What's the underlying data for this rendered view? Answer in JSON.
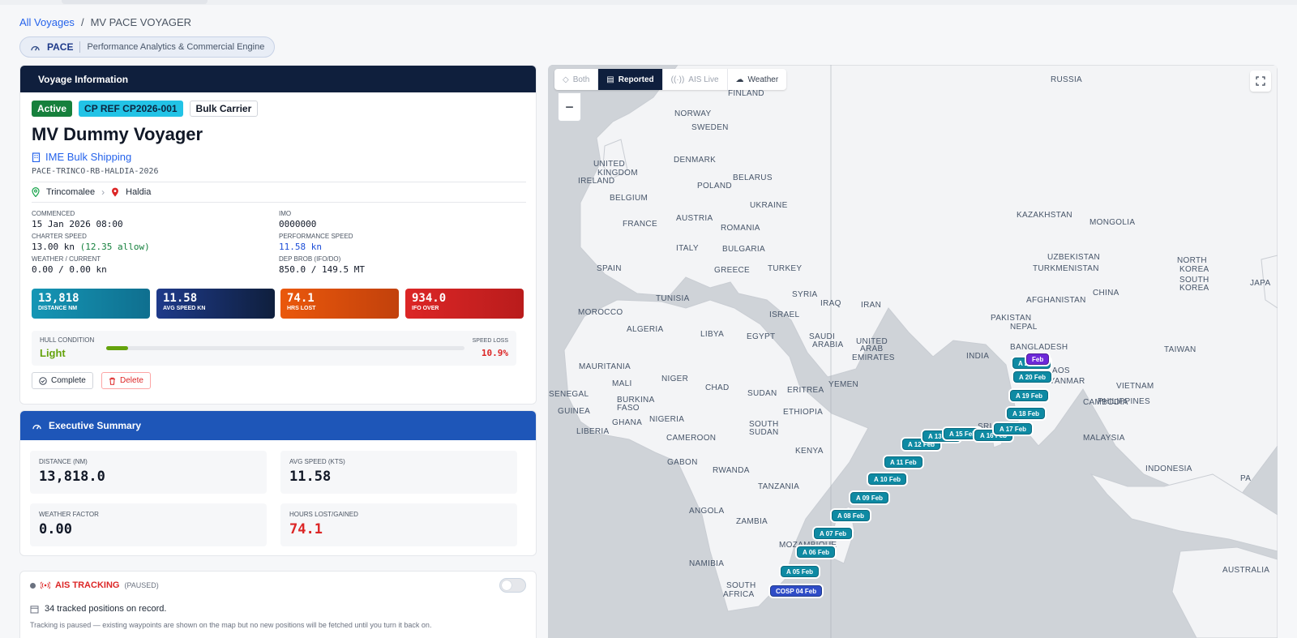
{
  "breadcrumb": {
    "root": "All Voyages",
    "sep": "/",
    "current": "MV PACE VOYAGER"
  },
  "brand": {
    "name": "PACE",
    "tagline": "Performance Analytics & Commercial Engine"
  },
  "voyage_card": {
    "title": "Voyage Information",
    "status": "Active",
    "cp_ref": "CP REF CP2026-001",
    "vessel_type": "Bulk Carrier",
    "vessel_name": "MV Dummy Voyager",
    "owner": "IME Bulk Shipping",
    "voyage_ref": "PACE-TRINCO-RB-HALDIA-2026",
    "origin": "Trincomalee",
    "destination": "Haldia",
    "commenced_label": "Commenced",
    "commenced": "15 Jan 2026 08:00",
    "imo_label": "IMO",
    "imo": "0000000",
    "charter_label": "Charter Speed",
    "charter": "13.00 kn",
    "charter_allow": "(12.35 allow)",
    "perf_label": "Performance Speed",
    "perf": "11.58 kn",
    "weather_label": "Weather / Current",
    "weather": "0.00 / 0.00 kn",
    "brob_label": "Dep BROB (IFO/DO)",
    "brob": "850.0 / 149.5 MT",
    "stats": [
      {
        "value": "13,818",
        "label": "Distance NM"
      },
      {
        "value": "11.58",
        "label": "Avg Speed KN"
      },
      {
        "value": "74.1",
        "label": "Hrs Lost"
      },
      {
        "value": "934.0",
        "label": "IFO Over"
      }
    ],
    "hull_label": "HULL CONDITION",
    "hull_value": "Light",
    "hull_fraction": 0.06,
    "speed_loss_label": "SPEED LOSS",
    "speed_loss": "10.9%",
    "complete_label": "Complete",
    "delete_label": "Delete"
  },
  "summary": {
    "title": "Executive Summary",
    "metrics": [
      {
        "label": "Distance (NM)",
        "value": "13,818.0"
      },
      {
        "label": "Avg Speed (kts)",
        "value": "11.58"
      },
      {
        "label": "Weather Factor",
        "value": "0.00"
      },
      {
        "label": "Hours Lost/Gained",
        "value": "74.1"
      }
    ]
  },
  "ais": {
    "title": "AIS TRACKING",
    "state": "(PAUSED)",
    "positions": "34 tracked positions on record.",
    "note": "Tracking is paused — existing waypoints are shown on the map but no new positions will be fetched until you turn it back on."
  },
  "map": {
    "modes": [
      "Both",
      "Reported",
      "AIS Live",
      "Weather"
    ],
    "active_mode": "Reported",
    "zoom_out": "−",
    "labels": [
      "RUSSIA",
      "FINLAND",
      "NORWAY",
      "SWEDEN",
      "DENMARK",
      "UNITED",
      "KINGDOM",
      "IRELAND",
      "BELARUS",
      "POLAND",
      "BELGIUM",
      "UKRAINE",
      "KAZAKHSTAN",
      "MONGOLIA",
      "FRANCE",
      "AUSTRIA",
      "ROMANIA",
      "ITALY",
      "BULGARIA",
      "UZBEKISTAN",
      "SPAIN",
      "GREECE",
      "TURKEY",
      "TURKMENISTAN",
      "NORTH",
      "KOREA",
      "SOUTH",
      "KOREA",
      "JAPA",
      "SYRIA",
      "CHINA",
      "TUNISIA",
      "IRAQ",
      "IRAN",
      "AFGHANISTAN",
      "MOROCCO",
      "ISRAEL",
      "PAKISTAN",
      "ALGERIA",
      "LIBYA",
      "EGYPT",
      "SAUDI",
      "ARABIA",
      "NEPAL",
      "UNITED",
      "ARAB",
      "EMIRATES",
      "INDIA",
      "BANGLADESH",
      "TAIWAN",
      "MAURITANIA",
      "MALI",
      "NIGER",
      "CHAD",
      "SUDAN",
      "ERITREA",
      "YEMEN",
      "LAOS",
      "VIETNAM",
      "SENEGAL",
      "BURKINA",
      "FASO",
      "MYANMAR",
      "CAMBODIA",
      "PHILIPPINES",
      "GUINEA",
      "GHANA",
      "NIGERIA",
      "SOUTH",
      "SUDAN",
      "ETHIOPIA",
      "LIBERIA",
      "CAMEROON",
      "SRI LA",
      "MALAYSIA",
      "GABON",
      "KENYA",
      "RWANDA",
      "INDONESIA",
      "TANZANIA",
      "PA",
      "ANGOLA",
      "ZAMBIA",
      "MOZAMBIQUE",
      "NAMIBIA",
      "SOUTH",
      "AFRICA",
      "AUSTRALIA"
    ],
    "markers": [
      "COSP 04 Feb",
      "A 05 Feb",
      "A 06 Feb",
      "A 07 Feb",
      "A 08 Feb",
      "A 09 Feb",
      "A 10 Feb",
      "A 11 Feb",
      "A 12 Feb",
      "A 13 Feb",
      "A 15 Feb",
      "A 16 Feb",
      "A 17 Feb",
      "A 18 Feb",
      "A 19 Feb",
      "A 20 Feb",
      "A 21 Feb",
      "Feb"
    ],
    "colors": {
      "water": "#cfd3d8",
      "land": "#f3f4f6",
      "marker": "#0e8aa3",
      "start": "#2f4cc7",
      "end": "#6d28d9"
    }
  }
}
